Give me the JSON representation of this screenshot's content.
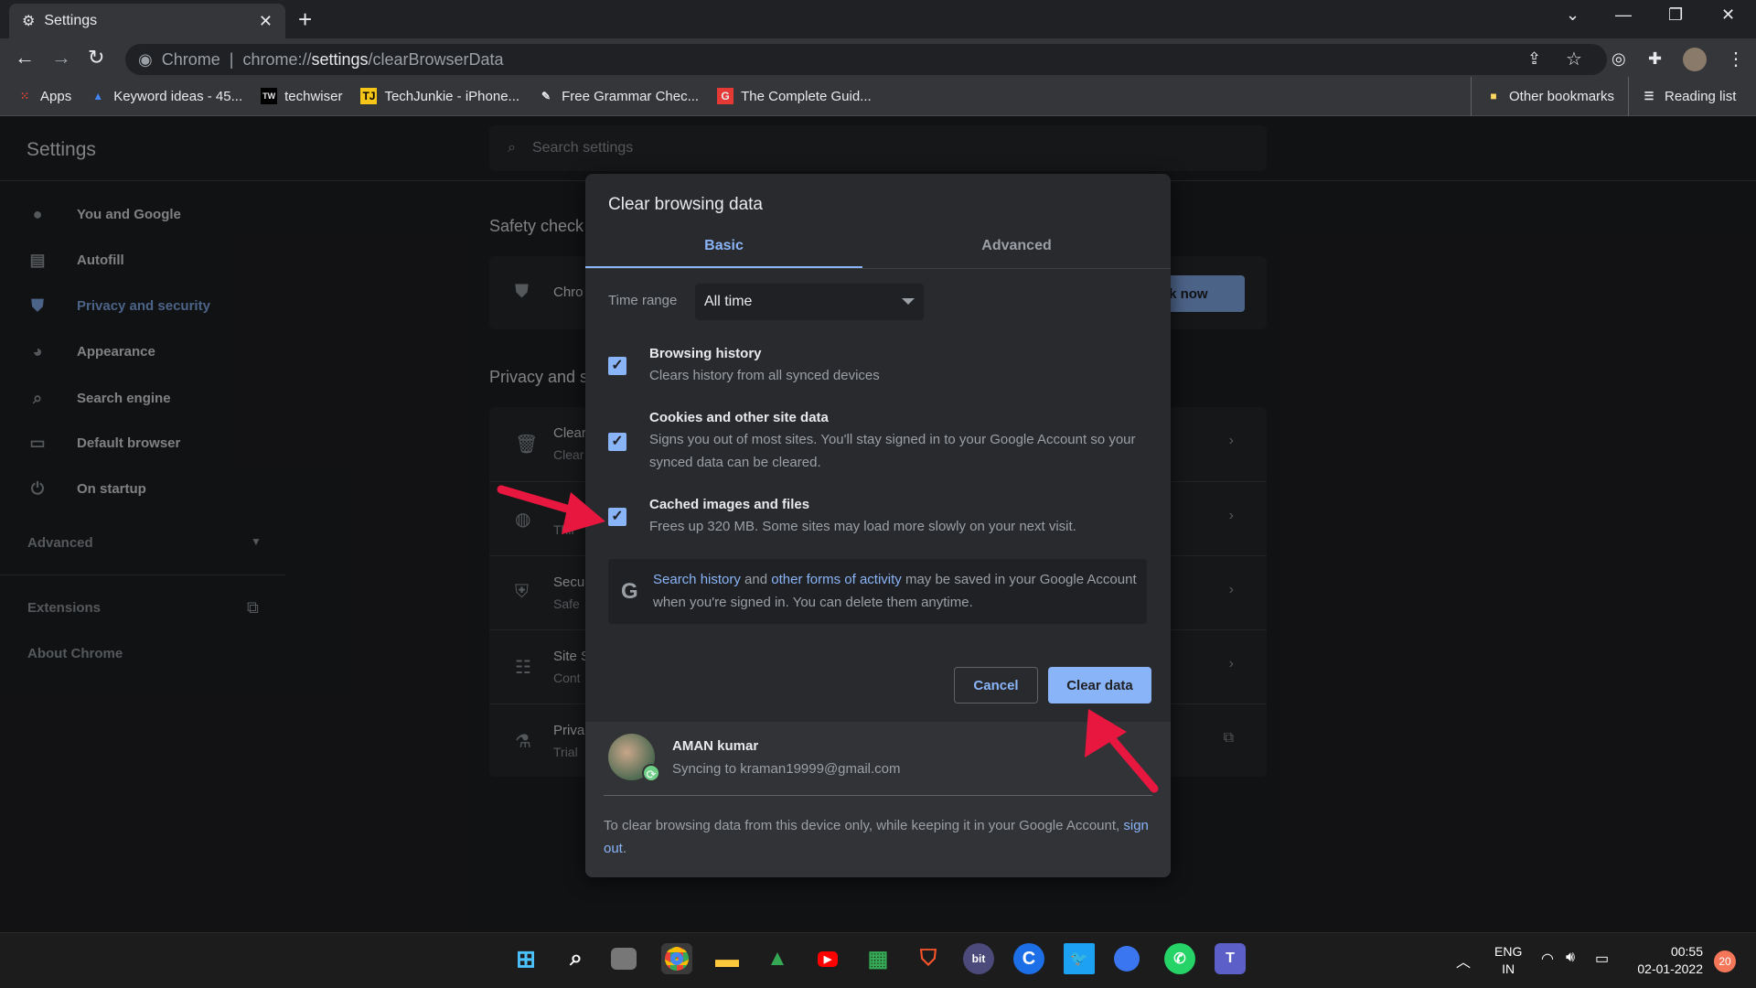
{
  "browser": {
    "tab_title": "Settings",
    "new_tab": "+",
    "url_prefix": "Chrome",
    "url_scheme": "chrome://",
    "url_host": "settings",
    "url_path": "/clearBrowserData",
    "bookmarks": [
      {
        "label": "Apps",
        "icon": "apps-grid-icon"
      },
      {
        "label": "Keyword ideas - 45...",
        "icon": "google-ads-icon"
      },
      {
        "label": "techwiser",
        "icon": "techwiser-icon"
      },
      {
        "label": "TechJunkie - iPhone...",
        "icon": "techjunkie-icon"
      },
      {
        "label": "Free Grammar Chec...",
        "icon": "pen-icon"
      },
      {
        "label": "The Complete Guid...",
        "icon": "g-red-icon"
      }
    ],
    "other_bookmarks": "Other bookmarks",
    "reading_list": "Reading list"
  },
  "settings": {
    "title": "Settings",
    "search_placeholder": "Search settings",
    "sidebar": [
      {
        "label": "You and Google",
        "icon": "person-icon"
      },
      {
        "label": "Autofill",
        "icon": "clipboard-icon"
      },
      {
        "label": "Privacy and security",
        "icon": "shield-icon",
        "active": true
      },
      {
        "label": "Appearance",
        "icon": "palette-icon"
      },
      {
        "label": "Search engine",
        "icon": "search-icon"
      },
      {
        "label": "Default browser",
        "icon": "browser-icon"
      },
      {
        "label": "On startup",
        "icon": "power-icon"
      }
    ],
    "advanced": "Advanced",
    "extensions": "Extensions",
    "about": "About Chrome",
    "safety_check": "Safety check",
    "safety_text": "Chro",
    "check_now": "eck now",
    "privacy_heading": "Privacy and s",
    "privacy_rows": [
      {
        "t1": "Clear",
        "t2": "Clear"
      },
      {
        "t1": "",
        "t2": "Thir"
      },
      {
        "t1": "Secu",
        "t2": "Safe"
      },
      {
        "t1": "Site S",
        "t2": "Cont"
      },
      {
        "t1": "Priva",
        "t2": "Trial"
      }
    ]
  },
  "dialog": {
    "title": "Clear browsing data",
    "tabs": [
      "Basic",
      "Advanced"
    ],
    "active_tab": "Basic",
    "time_range_label": "Time range",
    "time_range_value": "All time",
    "items": [
      {
        "title": "Browsing history",
        "desc": "Clears history from all synced devices",
        "checked": true
      },
      {
        "title": "Cookies and other site data",
        "desc": "Signs you out of most sites. You'll stay signed in to your Google Account so your synced data can be cleared.",
        "checked": true
      },
      {
        "title": "Cached images and files",
        "desc": "Frees up 320 MB. Some sites may load more slowly on your next visit.",
        "checked": true
      }
    ],
    "info": {
      "link1": "Search history",
      "and": " and ",
      "link2": "other forms of activity",
      "rest": " may be saved in your Google Account when you're signed in. You can delete them anytime."
    },
    "cancel": "Cancel",
    "clear": "Clear data",
    "account": {
      "name": "AMAN kumar",
      "email": "Syncing to kraman19999@gmail.com"
    },
    "footer_note": "To clear browsing data from this device only, while keeping it in your Google Account, ",
    "sign_out": "sign out",
    "period": "."
  },
  "taskbar": {
    "lang1": "ENG",
    "lang2": "IN",
    "time": "00:55",
    "date": "02-01-2022",
    "notifications": "20"
  },
  "colors": {
    "accent": "#8ab4f8",
    "annotation_arrow": "#e8173f"
  }
}
